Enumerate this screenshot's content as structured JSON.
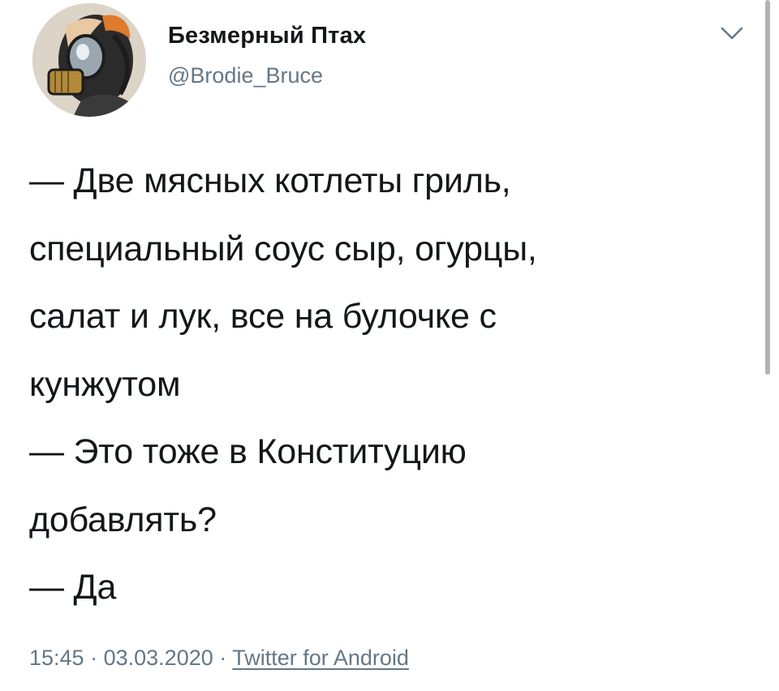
{
  "tweet": {
    "author": {
      "display_name": "Безмерный Птах",
      "handle": "@Brodie_Bruce",
      "avatar_icon": "gas-mask-avatar"
    },
    "menu_icon": "chevron-down-icon",
    "text_lines": [
      "— Две мясных котлеты гриль,",
      "специальный соус сыр, огурцы,",
      "салат и лук, все на булочке с",
      "кунжутом",
      "— Это тоже в Конституцию",
      "добавлять?",
      "— Да"
    ],
    "time": "15:45",
    "separator": "·",
    "date": "03.03.2020",
    "source": "Twitter for Android"
  },
  "colors": {
    "text": "#14171a",
    "secondary": "#657786",
    "background": "#ffffff"
  }
}
